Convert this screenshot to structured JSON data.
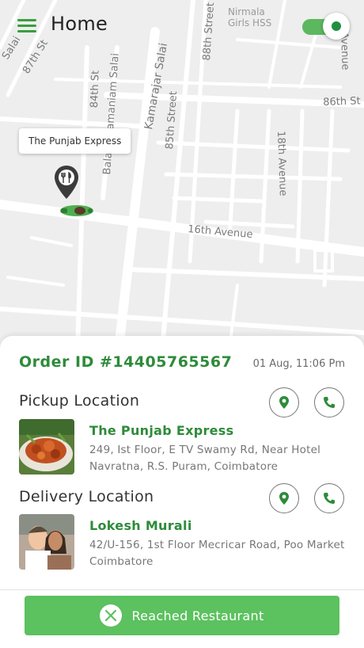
{
  "header": {
    "title": "Home",
    "online_toggle": "on"
  },
  "map": {
    "streets": {
      "street_87th": "87th St",
      "salai_top_left": "Salai",
      "street_84th": "84th St",
      "subramaniam_salai": "Balasubramaniam Salai",
      "kamarajar_salai": "Kamarajar Salai",
      "street_85th": "85th Street",
      "street_88th": "88th Street",
      "street_86th": "86th St",
      "avenue_18th": "18th Avenue",
      "avenue_16th": "16th Avenue",
      "nirmala_school": "Nirmala Girls HSS",
      "avenue_right": "Avenue"
    },
    "restaurant_tooltip": "The Punjab Express"
  },
  "order": {
    "id_label": "Order ID #14405765567",
    "time": "01 Aug, 11:06 Pm"
  },
  "pickup": {
    "section_title": "Pickup Location",
    "name": "The Punjab Express",
    "address": "249, Ist Floor, E TV Swamy Rd, Near Hotel Navratna, R.S. Puram, Coimbatore"
  },
  "delivery": {
    "section_title": "Delivery Location",
    "name": "Lokesh Murali",
    "address": "42/U-156, 1st Floor Mecricar Road, Poo Market Coimbatore"
  },
  "action": {
    "label": "Reached Restaurant"
  },
  "colors": {
    "accent": "#2e8b3a",
    "button": "#5cc15f"
  }
}
